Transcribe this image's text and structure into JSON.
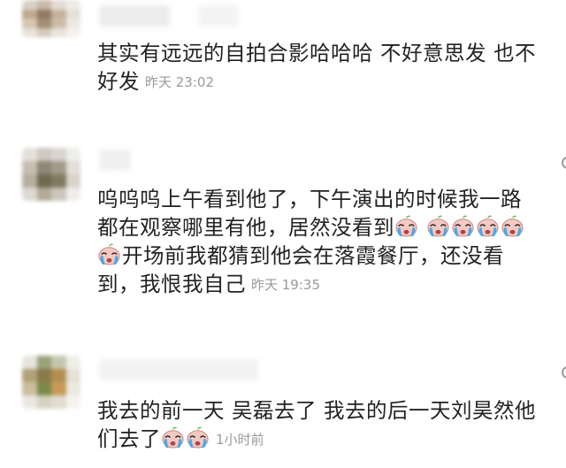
{
  "comments": [
    {
      "text": "其实有远远的自拍合影哈哈哈 不好意思发 也不好发",
      "time": "昨天 23:02"
    },
    {
      "text_a": "呜呜呜上午看到他了，下午演出的时候我一路都在观察哪里有他，居然没看到",
      "emoji_after_a": "crying-face-emoji",
      "emoji_row_count": 5,
      "text_b": "开场前我都猜到他会在落霞餐厅，还没看到，我恨我自己",
      "time": "昨天 19:35"
    },
    {
      "text": "我去的前一天 吴磊去了 我去的后一天刘昊然他们去了",
      "emoji_count": 2,
      "time": "1小时前"
    }
  ],
  "colors": {
    "text": "#222222",
    "time": "#9a9a9a",
    "background": "#ffffff"
  },
  "icons": [
    "blurred-avatar",
    "crying-face-emoji",
    "more-options-icon"
  ]
}
